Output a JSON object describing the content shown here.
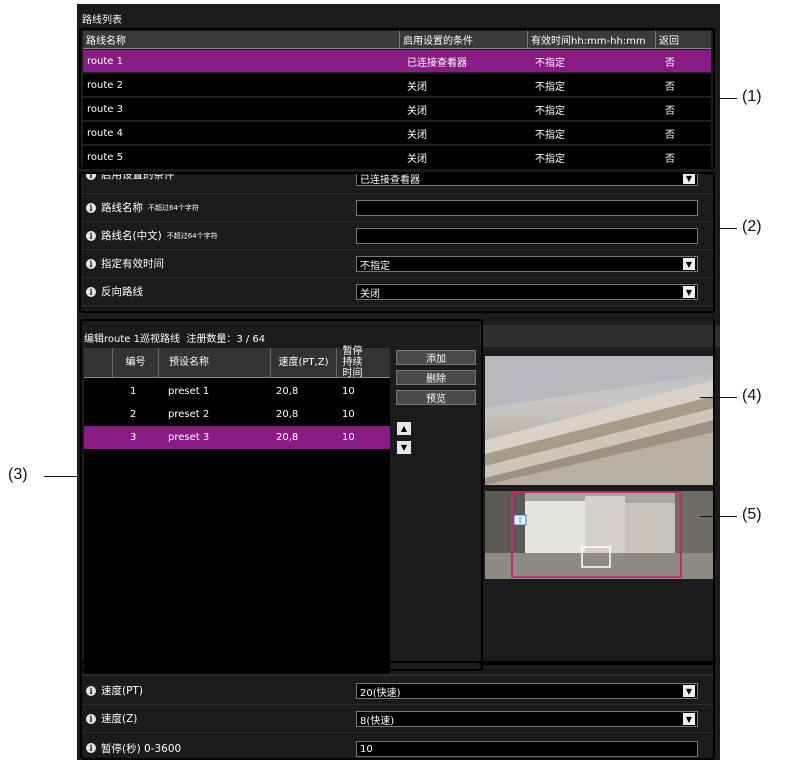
{
  "route_list": {
    "title": "路线列表",
    "headers": [
      "路线名称",
      "启用设置的条件",
      "有效时间hh:mm-hh:mm",
      "返回"
    ],
    "rows": [
      {
        "name": "route 1",
        "condition": "已连接查看器",
        "time": "不指定",
        "return": "否",
        "selected": true
      },
      {
        "name": "route 2",
        "condition": "关闭",
        "time": "不指定",
        "return": "否",
        "selected": false
      },
      {
        "name": "route 3",
        "condition": "关闭",
        "time": "不指定",
        "return": "否",
        "selected": false
      },
      {
        "name": "route 4",
        "condition": "关闭",
        "time": "不指定",
        "return": "否",
        "selected": false
      },
      {
        "name": "route 5",
        "condition": "关闭",
        "time": "不指定",
        "return": "否",
        "selected": false
      }
    ]
  },
  "route_settings": {
    "enable_condition": {
      "label": "启用设置的条件",
      "value": "已连接查看器"
    },
    "route_name": {
      "label": "路线名称",
      "hint": "不超过64个字符",
      "value": ""
    },
    "route_name_cn": {
      "label": "路线名(中文)",
      "hint": "不超过64个字符",
      "value": ""
    },
    "valid_time": {
      "label": "指定有效时间",
      "value": "不指定"
    },
    "reverse_route": {
      "label": "反向路线",
      "value": "关闭"
    }
  },
  "preset_editor": {
    "title": "编辑route 1巡视路线",
    "count_label": "注册数量：3 / 64",
    "headers": [
      "编号",
      "预设名称",
      "速度(PT,Z)",
      "暂停持续时间"
    ],
    "rows": [
      {
        "no": "1",
        "name": "preset 1",
        "speed": "20,8",
        "pause": "10",
        "selected": false
      },
      {
        "no": "2",
        "name": "preset 2",
        "speed": "20,8",
        "pause": "10",
        "selected": false
      },
      {
        "no": "3",
        "name": "preset 3",
        "speed": "20,8",
        "pause": "10",
        "selected": true
      }
    ],
    "buttons": {
      "add": "添加",
      "delete": "删除",
      "preview": "预览"
    },
    "move_up_icon": "triangle-up",
    "move_down_icon": "triangle-down"
  },
  "preset_settings": {
    "speed_pt": {
      "label": "速度(PT)",
      "value": "20(快速)"
    },
    "speed_z": {
      "label": "速度(Z)",
      "value": "8(快速)"
    },
    "pause": {
      "label": "暂停(秒) 0-3600",
      "value": "10"
    }
  },
  "callouts": [
    "(1)",
    "(2)",
    "(3)",
    "(4)",
    "(5)"
  ],
  "colors": {
    "selected_row": "#8a1b86",
    "panel_bg": "#1b1b1b",
    "table_bg": "#000000"
  }
}
